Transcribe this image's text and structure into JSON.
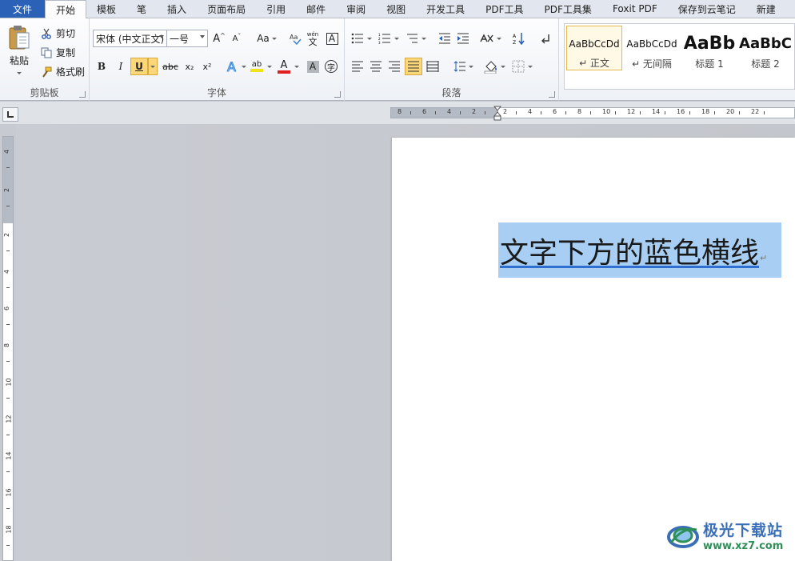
{
  "menubar": {
    "file_label": "文件",
    "tabs": [
      {
        "label": "开始"
      },
      {
        "label": "模板"
      },
      {
        "label": "笔"
      },
      {
        "label": "插入"
      },
      {
        "label": "页面布局"
      },
      {
        "label": "引用"
      },
      {
        "label": "邮件"
      },
      {
        "label": "审阅"
      },
      {
        "label": "视图"
      },
      {
        "label": "开发工具"
      },
      {
        "label": "PDF工具"
      },
      {
        "label": "PDF工具集"
      },
      {
        "label": "Foxit PDF"
      },
      {
        "label": "保存到云笔记"
      },
      {
        "label": "新建"
      }
    ],
    "active_tab": "开始"
  },
  "clipboard": {
    "group_label": "剪贴板",
    "paste_label": "粘贴",
    "cut_label": "剪切",
    "copy_label": "复制",
    "format_painter_label": "格式刷"
  },
  "font": {
    "group_label": "字体",
    "font_name": "宋体 (中文正文)",
    "font_size": "一号",
    "grow_glyph": "A",
    "shrink_glyph": "A",
    "change_case_glyph": "Aa",
    "phonetic_glyph": "wén",
    "phonetic_glyph2": "文",
    "border_glyph": "A",
    "bold": "B",
    "italic": "I",
    "underline": "U",
    "strike": "abc",
    "subscript": "x₂",
    "superscript": "x²",
    "highlight_glyph": "ab",
    "font_color_glyph": "A",
    "shading_glyph": "A",
    "enclose_glyph": "字",
    "font_color": "#e02020",
    "highlight_color": "#f2e21a"
  },
  "paragraph": {
    "group_label": "段落"
  },
  "styles": {
    "items": [
      {
        "sample": "AaBbCcDd",
        "name": "↵ 正文"
      },
      {
        "sample": "AaBbCcDd",
        "name": "↵ 无间隔"
      },
      {
        "sample": "AaBb",
        "name": "标题 1"
      },
      {
        "sample": "AaBbC",
        "name": "标题 2"
      }
    ]
  },
  "rulers": {
    "h_numbers": [
      "8",
      "6",
      "4",
      "2",
      "2",
      "4",
      "6",
      "8",
      "10",
      "12",
      "14",
      "16",
      "18",
      "20",
      "22"
    ],
    "v_numbers": [
      "4",
      "2",
      "2",
      "4",
      "6",
      "8",
      "10",
      "12",
      "14",
      "16",
      "18"
    ]
  },
  "document": {
    "selected_text": "文字下方的蓝色横线",
    "paragraph_mark": "↵",
    "underline_color": "#2e6fd0",
    "selection_color": "#a8cff3"
  },
  "watermark": {
    "title": "极光下载站",
    "url": "www.xz7.com"
  }
}
